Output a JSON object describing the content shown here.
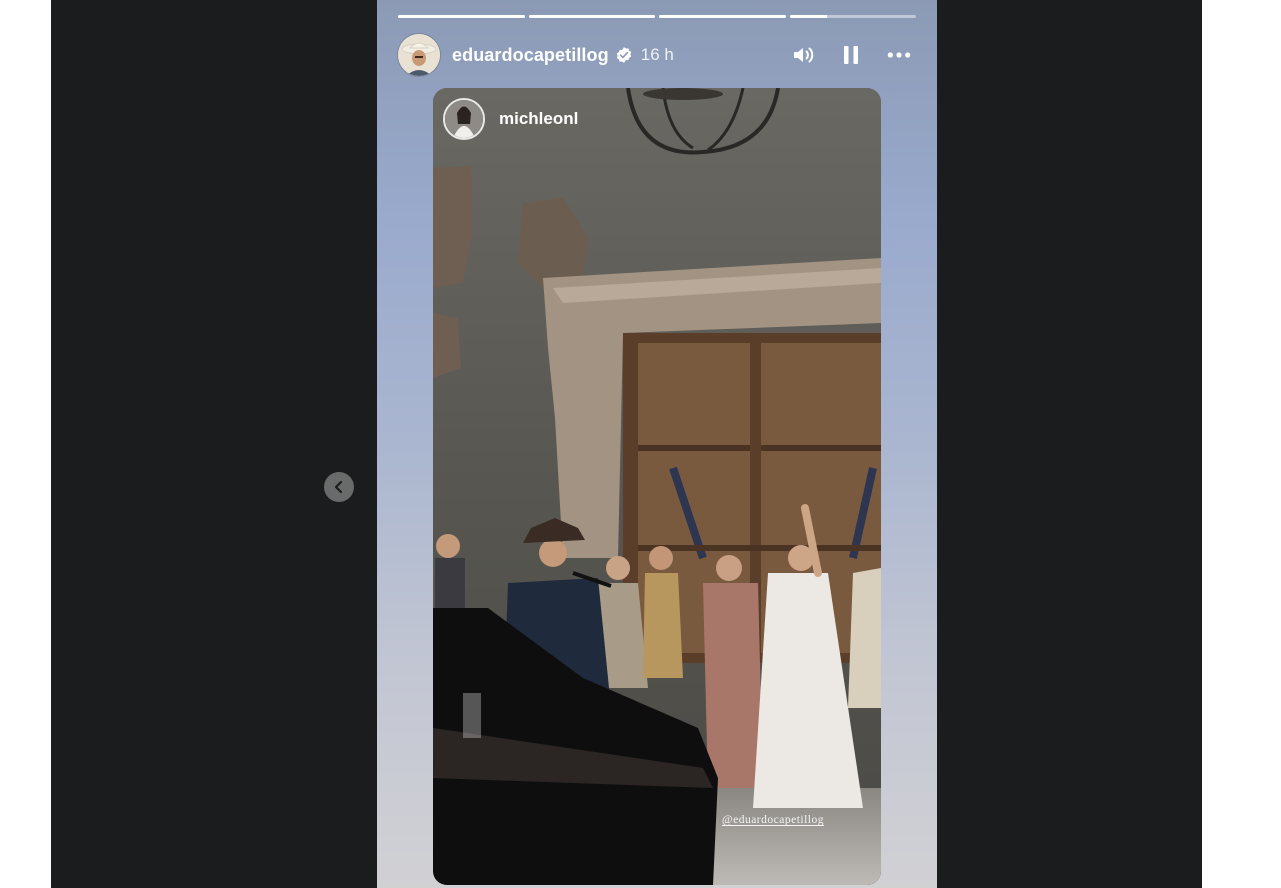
{
  "story": {
    "progress": [
      1,
      1,
      1,
      0.3
    ],
    "author": {
      "username": "eduardocapetillog",
      "verified": true,
      "time_ago": "16 h",
      "avatar_icon": "cowboy-hat-avatar"
    },
    "controls": {
      "mute_icon": "speaker-icon",
      "pause_icon": "pause-icon",
      "more_icon": "more-options-icon"
    },
    "shared_post": {
      "username": "michleonl",
      "mention_sticker": "@eduardocapetillog"
    }
  },
  "navigation": {
    "prev_icon": "chevron-left-icon"
  },
  "colors": {
    "frame_background": "#1a1c1d",
    "text": "#ffffff"
  }
}
